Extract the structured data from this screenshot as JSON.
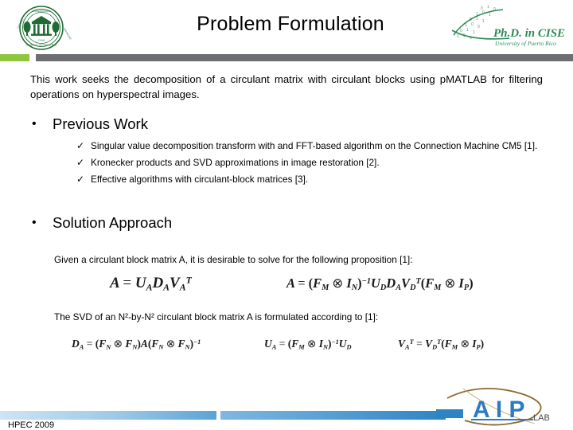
{
  "header": {
    "title": "Problem Formulation",
    "left_logo": {
      "name": "university-seal-logo",
      "ring_text_top": "COLEGIO DE MAYAGUEZ",
      "ring_text_bottom": "UNIVERSITY OF PUERTO RICO",
      "center_text": "CAAM",
      "color": "#1F6B33"
    },
    "right_logo": {
      "name": "phd-cise-logo",
      "primary_text": "Ph.D. in CISE",
      "secondary_text": "University of Puerto Rico",
      "binary_digits": "0 1 0 1 1 0 0 1 0 1 0 1 1 0 1 0 0 1",
      "color": "#2E8B57"
    },
    "accent_green": "#8DC63F",
    "accent_gray": "#6D6E71"
  },
  "body": {
    "intro": "This work seeks the decomposition of a circulant matrix with circulant blocks using pMATLAB for filtering operations on hyperspectral images.",
    "sections": [
      {
        "bullet": "•",
        "label": "Previous Work",
        "items": [
          {
            "mark": "✓",
            "text": "Singular value decomposition transform with and FFT-based algorithm on the Connection Machine CM5 [1]."
          },
          {
            "mark": "✓",
            "text": "Kronecker products and SVD approximations in image restoration [2]."
          },
          {
            "mark": "✓",
            "text": "Effective algorithms with circulant-block matrices [3]."
          }
        ]
      },
      {
        "bullet": "•",
        "label": "Solution Approach",
        "items": []
      }
    ],
    "proposition_1": "Given a circulant block matrix A, it is desirable to solve for the following proposition [1]:",
    "proposition_2": "The SVD of an N²-by-N² circulant block matrix A is formulated according to [1]:"
  },
  "equations": {
    "row1": [
      {
        "name": "equation-svd-basic",
        "plain": "A = U_A D_A V_A^T"
      },
      {
        "name": "equation-svd-expanded",
        "plain": "A = (F_M ⊗ I_N)^-1 U_D D_A V_D^T (F_M ⊗ I_P)"
      }
    ],
    "row2": [
      {
        "name": "equation-diagonal-da",
        "plain": "D_A = (F_N ⊗ F_N) A (F_N ⊗ F_N)^-1"
      },
      {
        "name": "equation-left-singular-ua",
        "plain": "U_A = (F_M ⊗ I_N)^-1 U_D"
      },
      {
        "name": "equation-right-singular-va",
        "plain": "V_A^T = V_D^T (F_M ⊗ I_P)"
      }
    ]
  },
  "footer": {
    "label": "HPEC 2009",
    "bar_color_light": "#CFE4F4",
    "bar_color_dark": "#2D84C4",
    "logo": {
      "name": "aip-lab-logo",
      "text": "AIP",
      "subtext": "LAB",
      "color": "#2D7CBF",
      "swoosh_color": "#8B6A2F"
    }
  }
}
